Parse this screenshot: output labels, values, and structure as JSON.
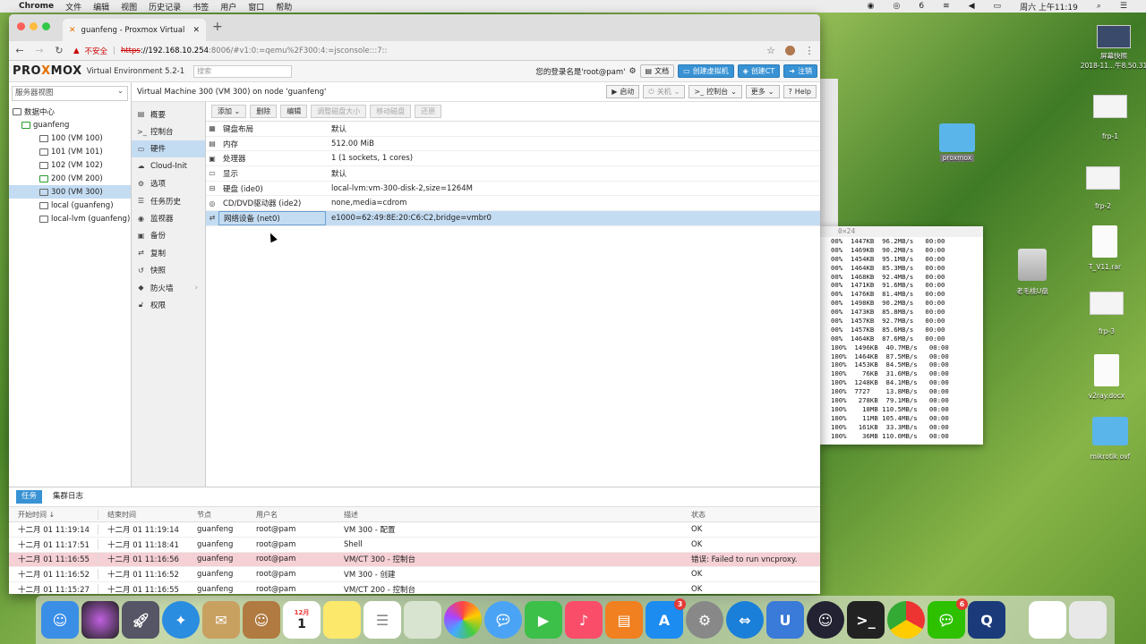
{
  "mac_menu": {
    "app": "Chrome",
    "items": [
      "文件",
      "编辑",
      "视图",
      "历史记录",
      "书签",
      "用户",
      "窗口",
      "帮助"
    ],
    "clock": "周六 上午11:19",
    "wechat_badge": "6"
  },
  "browser": {
    "tab_title": "guanfeng - Proxmox Virtual En",
    "insecure_label": "不安全",
    "url_scheme": "https",
    "url_host": "://192.168.10.254",
    "url_path": ":8006/#v1:0:=qemu%2F300:4:=jsconsole:::7::"
  },
  "pve": {
    "logo_left": "PRO",
    "logo_x": "X",
    "logo_right": "MOX",
    "version": "Virtual Environment 5.2-1",
    "search_placeholder": "搜索",
    "login_text": "您的登录名是'root@pam'",
    "btn_docs": "文档",
    "btn_create_vm": "创建虚拟机",
    "btn_create_ct": "创建CT",
    "btn_logout": "注销"
  },
  "tree": {
    "view": "服务器视图",
    "items": [
      {
        "label": "数据中心",
        "indent": 4
      },
      {
        "label": "guanfeng",
        "indent": 14
      },
      {
        "label": "100 (VM 100)",
        "indent": 34
      },
      {
        "label": "101 (VM 101)",
        "indent": 34
      },
      {
        "label": "102 (VM 102)",
        "indent": 34
      },
      {
        "label": "200 (VM 200)",
        "indent": 34
      },
      {
        "label": "300 (VM 300)",
        "indent": 34
      },
      {
        "label": "local (guanfeng)",
        "indent": 34
      },
      {
        "label": "local-lvm (guanfeng)",
        "indent": 34
      }
    ]
  },
  "vm": {
    "title": "Virtual Machine 300 (VM 300) on node 'guanfeng'",
    "btn_start": "启动",
    "btn_shutdown": "关机",
    "btn_console": "控制台",
    "btn_more": "更多",
    "btn_help": "Help"
  },
  "nav": [
    "概要",
    "控制台",
    "硬件",
    "Cloud-Init",
    "选项",
    "任务历史",
    "监视器",
    "备份",
    "复制",
    "快照",
    "防火墙",
    "权限"
  ],
  "hw_toolbar": [
    "添加",
    "删除",
    "编辑",
    "调整磁盘大小",
    "移动磁盘",
    "还原"
  ],
  "hardware": [
    {
      "key": "键盘布局",
      "value": "默认"
    },
    {
      "key": "内存",
      "value": "512.00 MiB"
    },
    {
      "key": "处理器",
      "value": "1 (1 sockets, 1 cores)"
    },
    {
      "key": "显示",
      "value": "默认"
    },
    {
      "key": "硬盘 (ide0)",
      "value": "local-lvm:vm-300-disk-2,size=1264M"
    },
    {
      "key": "CD/DVD驱动器 (ide2)",
      "value": "none,media=cdrom"
    },
    {
      "key": "网络设备 (net0)",
      "value": "e1000=62:49:8E:20:C6:C2,bridge=vmbr0"
    }
  ],
  "tasks": {
    "tabs": [
      "任务",
      "集群日志"
    ],
    "headers": [
      "开始时间 ↓",
      "结束时间",
      "节点",
      "用户名",
      "描述",
      "状态"
    ],
    "rows": [
      [
        "十二月 01 11:19:14",
        "十二月 01 11:19:14",
        "guanfeng",
        "root@pam",
        "VM 300 - 配置",
        "OK"
      ],
      [
        "十二月 01 11:17:51",
        "十二月 01 11:18:41",
        "guanfeng",
        "root@pam",
        "Shell",
        "OK"
      ],
      [
        "十二月 01 11:16:55",
        "十二月 01 11:16:56",
        "guanfeng",
        "root@pam",
        "VM/CT 300 - 控制台",
        "错误: Failed to run vncproxy."
      ],
      [
        "十二月 01 11:16:52",
        "十二月 01 11:16:52",
        "guanfeng",
        "root@pam",
        "VM 300 - 创建",
        "OK"
      ],
      [
        "十二月 01 11:15:27",
        "十二月 01 11:16:55",
        "guanfeng",
        "root@pam",
        "VM/CT 200 - 控制台",
        "OK"
      ]
    ]
  },
  "terminal": {
    "title": "0×24",
    "lines": [
      "00%  1447KB  96.2MB/s   00:00",
      "00%  1469KB  90.2MB/s   00:00",
      "00%  1454KB  95.1MB/s   00:00",
      "00%  1464KB  85.3MB/s   00:00",
      "00%  1468KB  92.4MB/s   00:00",
      "00%  1471KB  91.6MB/s   00:00",
      "00%  1476KB  81.4MB/s   00:00",
      "00%  1498KB  90.2MB/s   00:00",
      "00%  1473KB  85.8MB/s   00:00",
      "00%  1457KB  92.7MB/s   00:00",
      "00%  1457KB  85.6MB/s   00:00",
      "00%  1464KB  87.6MB/s   00:00",
      "100%  1496KB  40.7MB/s   00:00",
      "100%  1464KB  87.5MB/s   00:00",
      "100%  1453KB  84.5MB/s   00:00",
      "100%    76KB  31.6MB/s   00:00",
      "100%  1248KB  84.1MB/s   00:00",
      "100%  7727    13.8MB/s   00:00",
      "100%   278KB  79.1MB/s   00:00",
      "100%    18MB 110.5MB/s   00:00",
      "100%    11MB 105.4MB/s   00:00",
      "100%   161KB  33.3MB/s   00:00",
      "100%    36MB 110.0MB/s   00:00"
    ]
  },
  "desktop": [
    {
      "label": "屏幕快照\n2018-11...午8.50.31",
      "kind": "thumb"
    },
    {
      "label": "frp-1",
      "kind": "thumb"
    },
    {
      "label": "proxmox",
      "kind": "folder"
    },
    {
      "label": "frp-2",
      "kind": "thumb"
    },
    {
      "label": "T_V11.rar",
      "kind": "file"
    },
    {
      "label": "老毛桃U盘",
      "kind": "drive"
    },
    {
      "label": "frp-3",
      "kind": "thumb"
    },
    {
      "label": "v2ray.docx",
      "kind": "file"
    },
    {
      "label": "mikrotik ovf",
      "kind": "folder"
    }
  ],
  "dock": {
    "calendar_month": "12月",
    "calendar_day": "1",
    "appstore_badge": "3",
    "wechat_badge": "6"
  }
}
